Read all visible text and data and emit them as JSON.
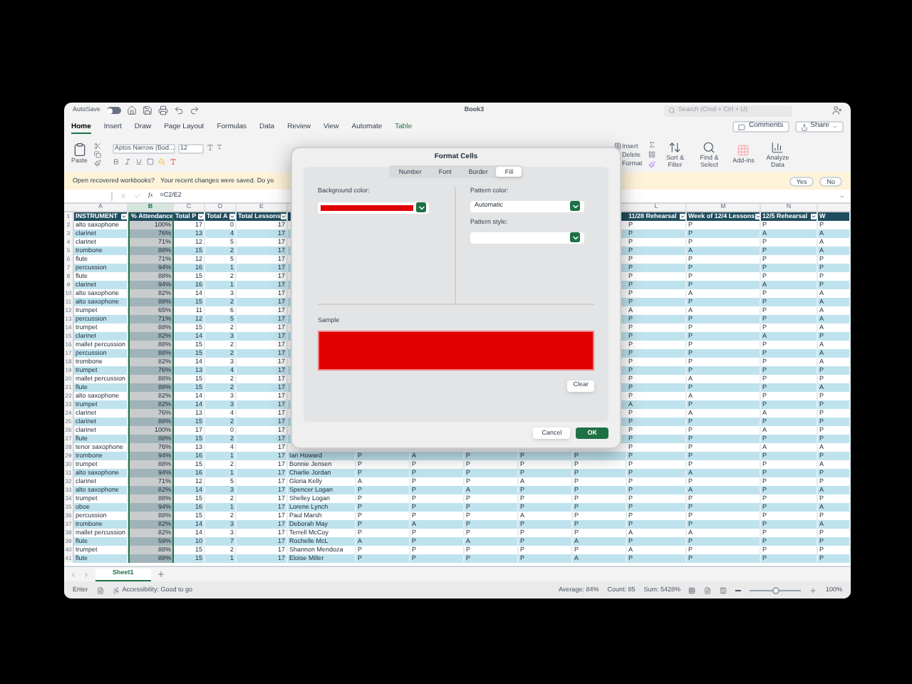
{
  "title_bar": {
    "autosave_label": "AutoSave",
    "autosave_on": false,
    "title": "Book3",
    "search_placeholder": "Search (Cmd + Ctrl + U)"
  },
  "ribbon_tabs": [
    {
      "label": "Home",
      "selected": true
    },
    {
      "label": "Insert",
      "selected": false
    },
    {
      "label": "Draw",
      "selected": false
    },
    {
      "label": "Page Layout",
      "selected": false
    },
    {
      "label": "Formulas",
      "selected": false
    },
    {
      "label": "Data",
      "selected": false
    },
    {
      "label": "Review",
      "selected": false
    },
    {
      "label": "View",
      "selected": false
    },
    {
      "label": "Automate",
      "selected": false
    },
    {
      "label": "Table",
      "selected": false
    }
  ],
  "ribbon": {
    "paste": "Paste",
    "font_name": "Aptos Narrow (Bod...",
    "font_size": "12",
    "comments": "Comments",
    "share": "Share",
    "cells_commands": [
      "Insert",
      "Delete",
      "Format"
    ],
    "sort_filter": "Sort & Filter",
    "find_select": "Find & Select",
    "add_ins": "Add-ins",
    "analyze": "Analyze Data"
  },
  "notification": {
    "title": "Open recovered workbooks?",
    "message": "Your recent changes were saved. Do yo",
    "buttons": [
      "Yes",
      "No"
    ]
  },
  "formula_bar": {
    "function_label": "fx",
    "formula": "=C2/E2"
  },
  "sheet": {
    "column_letters": {
      "A": {
        "letter": "A",
        "selected": false
      },
      "B": {
        "letter": "B",
        "selected": true
      },
      "C": {
        "letter": "C",
        "selected": false
      },
      "D": {
        "letter": "D",
        "selected": false
      },
      "E": {
        "letter": "E",
        "selected": false
      },
      "L": {
        "letter": "L",
        "selected": false
      },
      "M": {
        "letter": "M",
        "selected": false
      },
      "N": {
        "letter": "N",
        "selected": false
      }
    },
    "header": {
      "number": "1",
      "cells": {
        "A": "INSTRUMENT",
        "B": "% Attendance",
        "C": "Total P",
        "D": "Total A",
        "E": "Total Lessons",
        "L": "11/28 Rehearsal",
        "M": "Week of 12/4 Lessons",
        "N": "12/5 Rehearsal",
        "O": "W"
      }
    },
    "rows": [
      {
        "number": "2",
        "cells": {
          "A": "alto saxophone",
          "B": "100%",
          "C": "17",
          "D": "0",
          "E": "17",
          "L": "P",
          "M": "P",
          "N": "P",
          "O": "P"
        }
      },
      {
        "number": "3",
        "cells": {
          "A": "clarinet",
          "B": "76%",
          "C": "13",
          "D": "4",
          "E": "17",
          "L": "P",
          "M": "P",
          "N": "A",
          "O": "A"
        }
      },
      {
        "number": "4",
        "cells": {
          "A": "clarinet",
          "B": "71%",
          "C": "12",
          "D": "5",
          "E": "17",
          "L": "P",
          "M": "P",
          "N": "P",
          "O": "A"
        }
      },
      {
        "number": "5",
        "cells": {
          "A": "trombone",
          "B": "88%",
          "C": "15",
          "D": "2",
          "E": "17",
          "L": "P",
          "M": "A",
          "N": "P",
          "O": "A"
        }
      },
      {
        "number": "6",
        "cells": {
          "A": "flute",
          "B": "71%",
          "C": "12",
          "D": "5",
          "E": "17",
          "L": "P",
          "M": "P",
          "N": "P",
          "O": "P"
        }
      },
      {
        "number": "7",
        "cells": {
          "A": "percussion",
          "B": "94%",
          "C": "16",
          "D": "1",
          "E": "17",
          "L": "P",
          "M": "P",
          "N": "P",
          "O": "P"
        }
      },
      {
        "number": "8",
        "cells": {
          "A": "flute",
          "B": "88%",
          "C": "15",
          "D": "2",
          "E": "17",
          "L": "P",
          "M": "P",
          "N": "P",
          "O": "P"
        }
      },
      {
        "number": "9",
        "cells": {
          "A": "clarinet",
          "B": "94%",
          "C": "16",
          "D": "1",
          "E": "17",
          "L": "P",
          "M": "P",
          "N": "A",
          "O": "P"
        }
      },
      {
        "number": "10",
        "cells": {
          "A": "alto saxophone",
          "B": "82%",
          "C": "14",
          "D": "3",
          "E": "17",
          "L": "P",
          "M": "A",
          "N": "P",
          "O": "A"
        }
      },
      {
        "number": "11",
        "cells": {
          "A": "alto saxophone",
          "B": "88%",
          "C": "15",
          "D": "2",
          "E": "17",
          "L": "P",
          "M": "P",
          "N": "P",
          "O": "A"
        }
      },
      {
        "number": "12",
        "cells": {
          "A": "trumpet",
          "B": "65%",
          "C": "11",
          "D": "6",
          "E": "17",
          "L": "A",
          "M": "A",
          "N": "P",
          "O": "A"
        }
      },
      {
        "number": "13",
        "cells": {
          "A": "percussion",
          "B": "71%",
          "C": "12",
          "D": "5",
          "E": "17",
          "L": "P",
          "M": "P",
          "N": "P",
          "O": "A"
        }
      },
      {
        "number": "14",
        "cells": {
          "A": "trumpet",
          "B": "88%",
          "C": "15",
          "D": "2",
          "E": "17",
          "L": "P",
          "M": "P",
          "N": "P",
          "O": "A"
        }
      },
      {
        "number": "15",
        "cells": {
          "A": "clarinet",
          "B": "82%",
          "C": "14",
          "D": "3",
          "E": "17",
          "L": "P",
          "M": "P",
          "N": "A",
          "O": "P"
        }
      },
      {
        "number": "16",
        "cells": {
          "A": "mallet percussion",
          "B": "88%",
          "C": "15",
          "D": "2",
          "E": "17",
          "L": "P",
          "M": "P",
          "N": "P",
          "O": "A"
        }
      },
      {
        "number": "17",
        "cells": {
          "A": "percussion",
          "B": "88%",
          "C": "15",
          "D": "2",
          "E": "17",
          "L": "P",
          "M": "P",
          "N": "P",
          "O": "A"
        }
      },
      {
        "number": "18",
        "cells": {
          "A": "trombone",
          "B": "82%",
          "C": "14",
          "D": "3",
          "E": "17",
          "L": "P",
          "M": "P",
          "N": "P",
          "O": "A"
        }
      },
      {
        "number": "19",
        "cells": {
          "A": "trumpet",
          "B": "76%",
          "C": "13",
          "D": "4",
          "E": "17",
          "L": "P",
          "M": "P",
          "N": "P",
          "O": "P"
        }
      },
      {
        "number": "20",
        "cells": {
          "A": "mallet percussion",
          "B": "88%",
          "C": "15",
          "D": "2",
          "E": "17",
          "L": "P",
          "M": "A",
          "N": "P",
          "O": "P"
        }
      },
      {
        "number": "21",
        "cells": {
          "A": "flute",
          "B": "88%",
          "C": "15",
          "D": "2",
          "E": "17",
          "L": "P",
          "M": "P",
          "N": "P",
          "O": "A"
        }
      },
      {
        "number": "22",
        "cells": {
          "A": "alto saxophone",
          "B": "82%",
          "C": "14",
          "D": "3",
          "E": "17",
          "L": "P",
          "M": "A",
          "N": "P",
          "O": "P"
        }
      },
      {
        "number": "23",
        "cells": {
          "A": "trumpet",
          "B": "82%",
          "C": "14",
          "D": "3",
          "E": "17",
          "L": "A",
          "M": "P",
          "N": "P",
          "O": "P"
        }
      },
      {
        "number": "24",
        "cells": {
          "A": "clarinet",
          "B": "76%",
          "C": "13",
          "D": "4",
          "E": "17",
          "L": "P",
          "M": "A",
          "N": "A",
          "O": "P"
        }
      },
      {
        "number": "25",
        "cells": {
          "A": "clarinet",
          "B": "88%",
          "C": "15",
          "D": "2",
          "E": "17",
          "L": "P",
          "M": "P",
          "N": "P",
          "O": "P"
        }
      },
      {
        "number": "26",
        "cells": {
          "A": "clarinet",
          "B": "100%",
          "C": "17",
          "D": "0",
          "E": "17",
          "L": "P",
          "M": "P",
          "N": "A",
          "O": "P"
        }
      },
      {
        "number": "27",
        "cells": {
          "A": "flute",
          "B": "88%",
          "C": "15",
          "D": "2",
          "E": "17",
          "L": "P",
          "M": "P",
          "N": "P",
          "O": "P"
        }
      },
      {
        "number": "28",
        "cells": {
          "A": "tenor saxophone",
          "B": "76%",
          "C": "13",
          "D": "4",
          "E": "17",
          "L": "P",
          "M": "P",
          "N": "A",
          "O": "A"
        }
      },
      {
        "number": "29",
        "cells": {
          "A": "trombone",
          "B": "94%",
          "C": "16",
          "D": "1",
          "E": "17",
          "F": "Ian Howard",
          "G": "P",
          "H": "A",
          "I": "P",
          "J": "P",
          "K": "P",
          "L": "P",
          "M": "P",
          "N": "P",
          "O": "P"
        }
      },
      {
        "number": "30",
        "cells": {
          "A": "trumpet",
          "B": "88%",
          "C": "15",
          "D": "2",
          "E": "17",
          "F": "Bonnie Jensen",
          "G": "P",
          "H": "P",
          "I": "P",
          "J": "P",
          "K": "P",
          "L": "P",
          "M": "P",
          "N": "P",
          "O": "A"
        }
      },
      {
        "number": "31",
        "cells": {
          "A": "alto saxophone",
          "B": "94%",
          "C": "16",
          "D": "1",
          "E": "17",
          "F": "Charlie Jordan",
          "G": "P",
          "H": "P",
          "I": "P",
          "J": "P",
          "K": "P",
          "L": "P",
          "M": "A",
          "N": "P",
          "O": "P"
        }
      },
      {
        "number": "32",
        "cells": {
          "A": "clarinet",
          "B": "71%",
          "C": "12",
          "D": "5",
          "E": "17",
          "F": "Gloria Kelly",
          "G": "A",
          "H": "P",
          "I": "P",
          "J": "A",
          "K": "P",
          "L": "P",
          "M": "P",
          "N": "P",
          "O": "P"
        }
      },
      {
        "number": "33",
        "cells": {
          "A": "alto saxophone",
          "B": "82%",
          "C": "14",
          "D": "3",
          "E": "17",
          "F": "Spencer Logan",
          "G": "P",
          "H": "P",
          "I": "A",
          "J": "P",
          "K": "P",
          "L": "P",
          "M": "A",
          "N": "P",
          "O": "A"
        }
      },
      {
        "number": "34",
        "cells": {
          "A": "trumpet",
          "B": "88%",
          "C": "15",
          "D": "2",
          "E": "17",
          "F": "Shelley Logan",
          "G": "P",
          "H": "P",
          "I": "P",
          "J": "P",
          "K": "P",
          "L": "P",
          "M": "P",
          "N": "P",
          "O": "P"
        }
      },
      {
        "number": "35",
        "cells": {
          "A": "oboe",
          "B": "94%",
          "C": "16",
          "D": "1",
          "E": "17",
          "F": "Lorene Lynch",
          "G": "P",
          "H": "P",
          "I": "P",
          "J": "P",
          "K": "P",
          "L": "P",
          "M": "P",
          "N": "P",
          "O": "A"
        }
      },
      {
        "number": "36",
        "cells": {
          "A": "percussion",
          "B": "88%",
          "C": "15",
          "D": "2",
          "E": "17",
          "F": "Paul Marsh",
          "G": "P",
          "H": "P",
          "I": "P",
          "J": "A",
          "K": "P",
          "L": "P",
          "M": "P",
          "N": "P",
          "O": "P"
        }
      },
      {
        "number": "37",
        "cells": {
          "A": "trombone",
          "B": "82%",
          "C": "14",
          "D": "3",
          "E": "17",
          "F": "Deborah May",
          "G": "P",
          "H": "A",
          "I": "P",
          "J": "P",
          "K": "P",
          "L": "P",
          "M": "P",
          "N": "P",
          "O": "A"
        }
      },
      {
        "number": "38",
        "cells": {
          "A": "mallet percussion",
          "B": "82%",
          "C": "14",
          "D": "3",
          "E": "17",
          "F": "Terrell McCoy",
          "G": "P",
          "H": "P",
          "I": "P",
          "J": "P",
          "K": "P",
          "L": "A",
          "M": "A",
          "N": "P",
          "O": "P"
        }
      },
      {
        "number": "39",
        "cells": {
          "A": "flute",
          "B": "59%",
          "C": "10",
          "D": "7",
          "E": "17",
          "F": "Rochelle McL",
          "G": "A",
          "H": "P",
          "I": "A",
          "J": "P",
          "K": "A",
          "L": "P",
          "M": "P",
          "N": "P",
          "O": "P"
        }
      },
      {
        "number": "40",
        "cells": {
          "A": "trumpet",
          "B": "88%",
          "C": "15",
          "D": "2",
          "E": "17",
          "F": "Shannon Mendoza",
          "G": "P",
          "H": "P",
          "I": "P",
          "J": "P",
          "K": "P",
          "L": "A",
          "M": "P",
          "N": "P",
          "O": "P"
        }
      },
      {
        "number": "41",
        "cells": {
          "A": "flute",
          "B": "88%",
          "C": "15",
          "D": "1",
          "E": "17",
          "F": "Eloise Miller",
          "G": "P",
          "H": "P",
          "I": "P",
          "J": "P",
          "K": "A",
          "L": "P",
          "M": "P",
          "N": "P",
          "O": "P"
        }
      }
    ]
  },
  "sheet_tabs": [
    {
      "label": "Sheet1",
      "selected": true
    }
  ],
  "status_bar": {
    "mode": "Enter",
    "accessibility": "Accessibility: Good to go",
    "average": "Average: 84%",
    "count": "Count: 85",
    "sum": "Sum: 5428%",
    "zoom_slider": {
      "level": 0.5
    },
    "zoom": "100%"
  },
  "dialog": {
    "title": "Format Cells",
    "tabs": [
      {
        "label": "Number",
        "selected": false
      },
      {
        "label": "Font",
        "selected": false
      },
      {
        "label": "Border",
        "selected": false
      },
      {
        "label": "Fill",
        "selected": true
      }
    ],
    "background_color_label": "Background color:",
    "background_fill": {
      "color": "#e00000"
    },
    "pattern_color_label": "Pattern color:",
    "pattern_color": "Automatic",
    "pattern_style_label": "Pattern style:",
    "sample_label": "Sample",
    "clear": "Clear",
    "cancel": "Cancel",
    "ok": "OK"
  }
}
